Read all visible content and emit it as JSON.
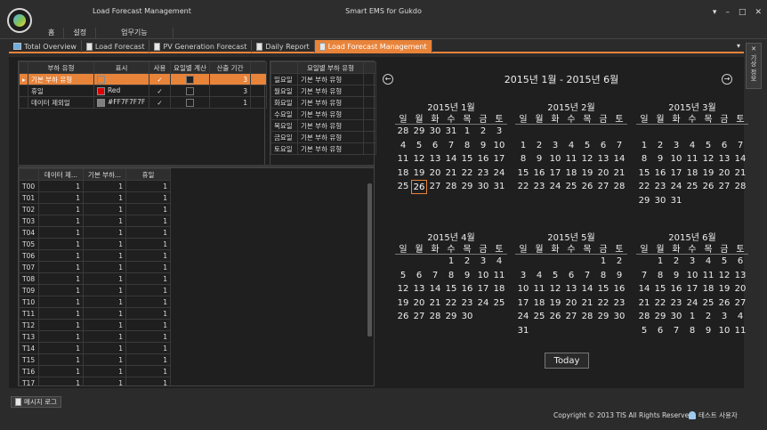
{
  "app": {
    "section": "Load Forecast Management",
    "title": "Smart EMS for Gukdo",
    "controls": [
      "▾",
      "–",
      "□",
      "✕"
    ]
  },
  "ribbon_tabs": [
    "홈",
    "설정",
    "업무기능"
  ],
  "doc_tabs": [
    {
      "label": "Total Overview",
      "icon": "monitor-icon"
    },
    {
      "label": "Load Forecast",
      "icon": "document-icon"
    },
    {
      "label": "PV Generation Forecast",
      "icon": "document-icon"
    },
    {
      "label": "Daily Report",
      "icon": "document-icon"
    },
    {
      "label": "Load Forecast Management",
      "icon": "document-icon",
      "active": true
    }
  ],
  "tabs_dropdown": "▾",
  "side_panel": {
    "pin": "✕",
    "label": "기상 정보"
  },
  "load_grid": {
    "headers": [
      "부하 유형",
      "표시",
      "사용",
      "요일별 계산",
      "산출 기간"
    ],
    "rows": [
      {
        "marker": "▸",
        "type": "기본 부하 유형",
        "color_label": "",
        "color": "#e8833a",
        "use": "✓",
        "weekday_calc": true,
        "period": "3",
        "selected": true
      },
      {
        "marker": "",
        "type": "휴일",
        "color_label": "Red",
        "color": "#e00000",
        "use": "✓",
        "weekday_calc": false,
        "period": "3",
        "selected": false
      },
      {
        "marker": "",
        "type": "데이터 제외일",
        "color_label": "#FF7F7F7F",
        "color": "#7f7f7f",
        "use": "✓",
        "weekday_calc": false,
        "period": "1",
        "selected": false
      }
    ]
  },
  "day_grid": {
    "header": "요일별 부하 유형",
    "rows": [
      {
        "day": "일요일",
        "type": "기본 부하 유형"
      },
      {
        "day": "월요일",
        "type": "기본 부하 유형"
      },
      {
        "day": "화요일",
        "type": "기본 부하 유형"
      },
      {
        "day": "수요일",
        "type": "기본 부하 유형"
      },
      {
        "day": "목요일",
        "type": "기본 부하 유형"
      },
      {
        "day": "금요일",
        "type": "기본 부하 유형"
      },
      {
        "day": "토요일",
        "type": "기본 부하 유형"
      }
    ]
  },
  "data_grid": {
    "headers": [
      "",
      "데이터 제...",
      "기본 부하...",
      "휴일"
    ],
    "rows": [
      [
        "T00",
        "1",
        "1",
        "1"
      ],
      [
        "T01",
        "1",
        "1",
        "1"
      ],
      [
        "T02",
        "1",
        "1",
        "1"
      ],
      [
        "T03",
        "1",
        "1",
        "1"
      ],
      [
        "T04",
        "1",
        "1",
        "1"
      ],
      [
        "T05",
        "1",
        "1",
        "1"
      ],
      [
        "T06",
        "1",
        "1",
        "1"
      ],
      [
        "T07",
        "1",
        "1",
        "1"
      ],
      [
        "T08",
        "1",
        "1",
        "1"
      ],
      [
        "T09",
        "1",
        "1",
        "1"
      ],
      [
        "T10",
        "1",
        "1",
        "1"
      ],
      [
        "T11",
        "1",
        "1",
        "1"
      ],
      [
        "T12",
        "1",
        "1",
        "1"
      ],
      [
        "T13",
        "1",
        "1",
        "1"
      ],
      [
        "T14",
        "1",
        "1",
        "1"
      ],
      [
        "T15",
        "1",
        "1",
        "1"
      ],
      [
        "T16",
        "1",
        "1",
        "1"
      ],
      [
        "T17",
        "1",
        "1",
        "1"
      ]
    ]
  },
  "calendar": {
    "range": "2015년 1월 - 2015년 6월",
    "prev": "←",
    "next": "→",
    "weekdays": [
      "일",
      "월",
      "화",
      "수",
      "목",
      "금",
      "토"
    ],
    "months": [
      {
        "title": "2015년 1월",
        "days": [
          "28",
          "29",
          "30",
          "31",
          "1",
          "2",
          "3",
          "4",
          "5",
          "6",
          "7",
          "8",
          "9",
          "10",
          "11",
          "12",
          "13",
          "14",
          "15",
          "16",
          "17",
          "18",
          "19",
          "20",
          "21",
          "22",
          "23",
          "24",
          "25",
          "26",
          "27",
          "28",
          "29",
          "30",
          "31"
        ],
        "today_index": 29
      },
      {
        "title": "2015년 2월",
        "days": [
          "",
          "",
          "",
          "",
          "",
          "",
          "",
          "1",
          "2",
          "3",
          "4",
          "5",
          "6",
          "7",
          "8",
          "9",
          "10",
          "11",
          "12",
          "13",
          "14",
          "15",
          "16",
          "17",
          "18",
          "19",
          "20",
          "21",
          "22",
          "23",
          "24",
          "25",
          "26",
          "27",
          "28"
        ],
        "today_index": -1
      },
      {
        "title": "2015년 3월",
        "days": [
          "",
          "",
          "",
          "",
          "",
          "",
          "",
          "1",
          "2",
          "3",
          "4",
          "5",
          "6",
          "7",
          "8",
          "9",
          "10",
          "11",
          "12",
          "13",
          "14",
          "15",
          "16",
          "17",
          "18",
          "19",
          "20",
          "21",
          "22",
          "23",
          "24",
          "25",
          "26",
          "27",
          "28",
          "29",
          "30",
          "31"
        ],
        "today_index": -1
      },
      {
        "title": "2015년 4월",
        "days": [
          "",
          "",
          "",
          "1",
          "2",
          "3",
          "4",
          "5",
          "6",
          "7",
          "8",
          "9",
          "10",
          "11",
          "12",
          "13",
          "14",
          "15",
          "16",
          "17",
          "18",
          "19",
          "20",
          "21",
          "22",
          "23",
          "24",
          "25",
          "26",
          "27",
          "28",
          "29",
          "30"
        ],
        "today_index": -1
      },
      {
        "title": "2015년 5월",
        "days": [
          "",
          "",
          "",
          "",
          "",
          "1",
          "2",
          "3",
          "4",
          "5",
          "6",
          "7",
          "8",
          "9",
          "10",
          "11",
          "12",
          "13",
          "14",
          "15",
          "16",
          "17",
          "18",
          "19",
          "20",
          "21",
          "22",
          "23",
          "24",
          "25",
          "26",
          "27",
          "28",
          "29",
          "30",
          "31"
        ],
        "today_index": -1
      },
      {
        "title": "2015년 6월",
        "days": [
          "",
          "1",
          "2",
          "3",
          "4",
          "5",
          "6",
          "7",
          "8",
          "9",
          "10",
          "11",
          "12",
          "13",
          "14",
          "15",
          "16",
          "17",
          "18",
          "19",
          "20",
          "21",
          "22",
          "23",
          "24",
          "25",
          "26",
          "27",
          "28",
          "29",
          "30",
          "1",
          "2",
          "3",
          "4",
          "5",
          "6",
          "7",
          "8",
          "9",
          "10",
          "11"
        ],
        "today_index": -1
      }
    ],
    "today_label": "Today"
  },
  "status": {
    "message_log": "메시지 로그",
    "copyright": "Copyright © 2013 TIS All Rights Reserved.",
    "user": "테스트 사용자"
  }
}
